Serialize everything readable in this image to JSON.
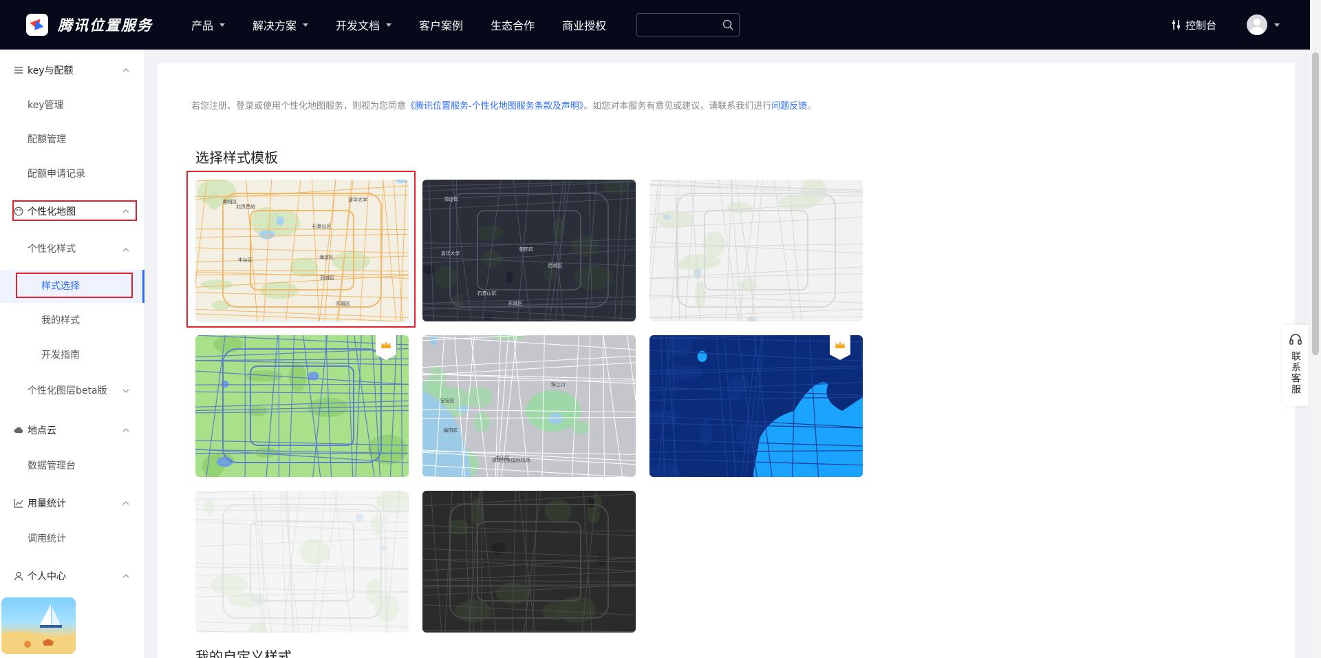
{
  "header": {
    "logo_text": "腾讯位置服务",
    "nav": [
      {
        "label": "产品",
        "has_caret": true
      },
      {
        "label": "解决方案",
        "has_caret": true
      },
      {
        "label": "开发文档",
        "has_caret": true
      },
      {
        "label": "客户案例",
        "has_caret": false
      },
      {
        "label": "生态合作",
        "has_caret": false
      },
      {
        "label": "商业授权",
        "has_caret": false
      }
    ],
    "search_placeholder": "",
    "console_label": "控制台"
  },
  "sidebar": {
    "groups": [
      {
        "label": "key与配额",
        "icon": "sliders-icon",
        "items": [
          "key管理",
          "配额管理",
          "配额申请记录"
        ]
      },
      {
        "label": "个性化地图",
        "icon": "palette-icon",
        "sub": [
          {
            "label": "个性化样式",
            "items": [
              "样式选择",
              "我的样式",
              "开发指南"
            ]
          },
          {
            "label": "个性化图层beta版",
            "items": []
          }
        ]
      },
      {
        "label": "地点云",
        "icon": "cloud-icon",
        "items": [
          "数据管理台"
        ]
      },
      {
        "label": "用量统计",
        "icon": "chart-icon",
        "items": [
          "调用统计"
        ]
      },
      {
        "label": "个人中心",
        "icon": "user-icon",
        "items": []
      }
    ],
    "active_item": "样式选择"
  },
  "main": {
    "notice_prefix": "若您注册、登录或使用个性化地图服务，则视为您同意",
    "notice_link": "《腾讯位置服务-个性化地图服务条款及声明》",
    "notice_middle": "。如您对本服务有意见或建议，请联系我们进行",
    "notice_feedback": "问题反馈",
    "notice_end": "。",
    "section_title": "选择样式模板",
    "section_title_2": "我的自定义样式",
    "templates": [
      {
        "name": "classic-light",
        "selected": true,
        "premium": false,
        "bg": "#f3efe2",
        "road": "#f0b86a",
        "water": "#a9d1f0",
        "green": "#cfe6b9"
      },
      {
        "name": "dark",
        "selected": false,
        "premium": false,
        "bg": "#2a2e38",
        "road": "#4a5060",
        "water": "#1d2230",
        "green": "#2f3b35"
      },
      {
        "name": "gray-light",
        "selected": false,
        "premium": false,
        "bg": "#f2f2f2",
        "road": "#d8d8d8",
        "water": "#cfdde8",
        "green": "#dfead6"
      },
      {
        "name": "green",
        "selected": false,
        "premium": true,
        "bg": "#a9e08a",
        "road": "#5d7fc6",
        "water": "#6fa0e0",
        "green": "#8fd06e"
      },
      {
        "name": "gray-coast",
        "selected": false,
        "premium": false,
        "bg": "#c4c6cc",
        "road": "#ffffff",
        "water": "#9ccbe8",
        "green": "#9fd8a8"
      },
      {
        "name": "deep-blue",
        "selected": false,
        "premium": true,
        "bg": "#0b2c7a",
        "road": "#1c3f95",
        "water": "#1aa3ff",
        "green": "#0f3587"
      },
      {
        "name": "white",
        "selected": false,
        "premium": false,
        "bg": "#f5f5f5",
        "road": "#e2e2e2",
        "water": "#dde8f0",
        "green": "#e6efe0"
      },
      {
        "name": "night-black",
        "selected": false,
        "premium": false,
        "bg": "#2b2b2b",
        "road": "#4a4a4a",
        "water": "#222",
        "green": "#34402f"
      }
    ],
    "map_labels": {
      "t1": [
        "清华大学",
        "海淀区",
        "西城区",
        "东城区",
        "石景山区",
        "朝阳区",
        "丰台区",
        "北京西站"
      ],
      "t2": [
        "清华大学",
        "海淀区",
        "西城区",
        "东城区",
        "石景山区",
        "朝阳区"
      ],
      "t5": [
        "深圳宝安国际机场",
        "宝安区",
        "珠江口",
        "南山区",
        "福田区"
      ]
    }
  },
  "float": {
    "service_label": "联系客服"
  }
}
